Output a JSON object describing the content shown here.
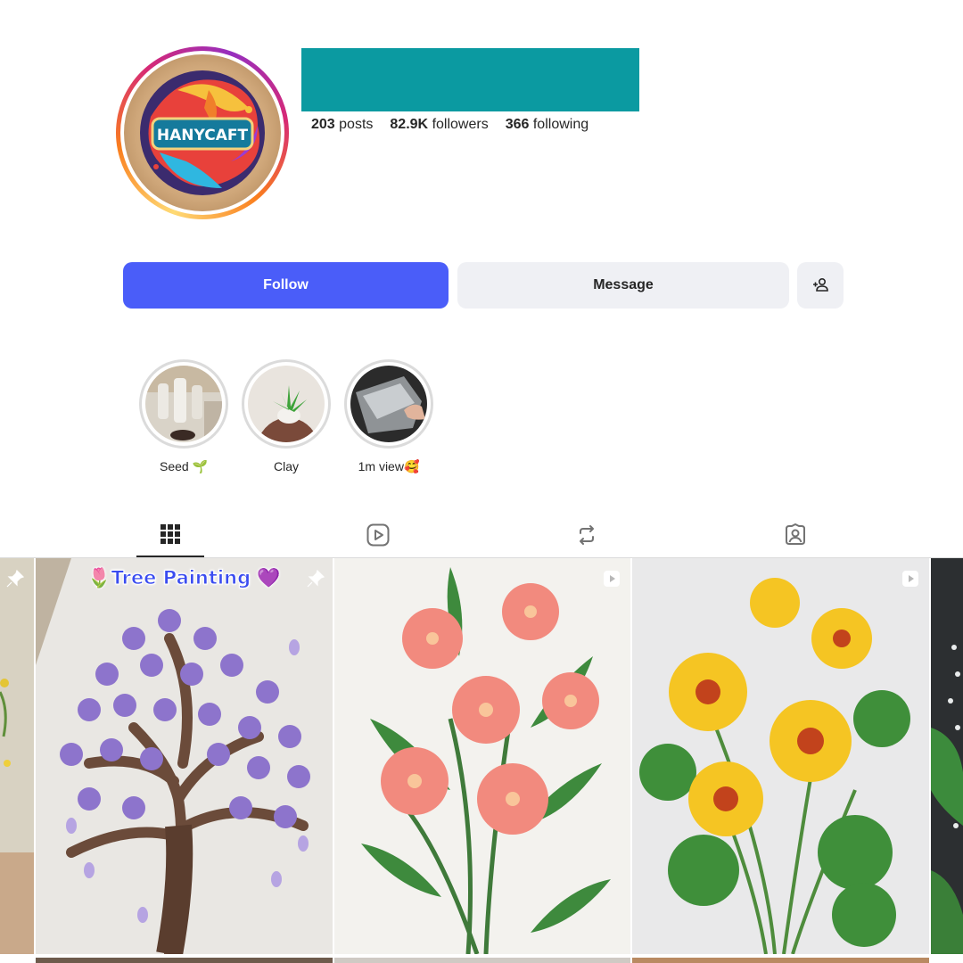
{
  "profile": {
    "avatar_text": "HANYCAFT",
    "stats": {
      "posts_count": "203",
      "posts_label": "posts",
      "followers_count": "82.9K",
      "followers_label": "followers",
      "following_count": "366",
      "following_label": "following"
    }
  },
  "actions": {
    "follow_label": "Follow",
    "message_label": "Message",
    "add_user_icon": "add-person-icon"
  },
  "highlights": [
    {
      "label": "Seed 🌱"
    },
    {
      "label": "Clay"
    },
    {
      "label": "1m view🥰"
    }
  ],
  "tabs": [
    {
      "icon": "grid-icon",
      "active": true
    },
    {
      "icon": "reels-icon",
      "active": false
    },
    {
      "icon": "reposts-icon",
      "active": false
    },
    {
      "icon": "tagged-icon",
      "active": false
    }
  ],
  "posts": [
    {
      "type": "pinned",
      "caption": ""
    },
    {
      "type": "pinned",
      "caption": "🌷Tree Painting 💜"
    },
    {
      "type": "reel",
      "caption": ""
    },
    {
      "type": "reel",
      "caption": ""
    }
  ],
  "colors": {
    "follow_button": "#4a5df9",
    "secondary_button": "#eff0f4",
    "name_placeholder": "#0b9aa1"
  }
}
